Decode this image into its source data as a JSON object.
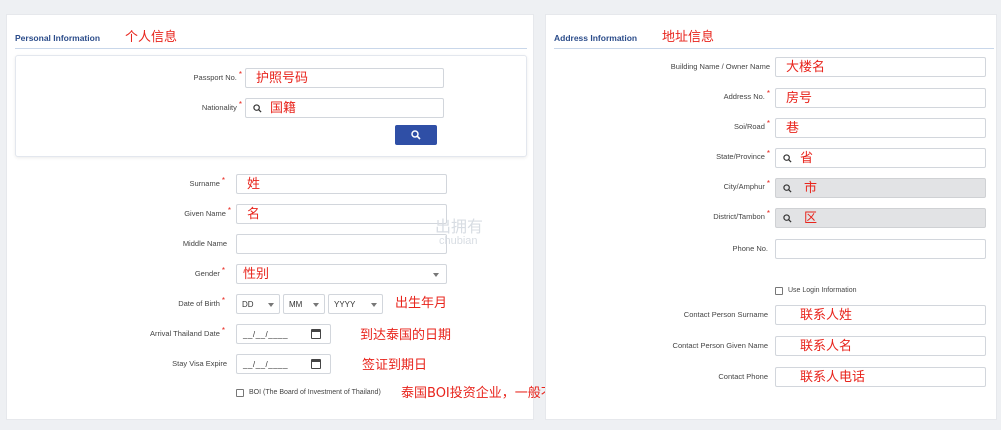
{
  "personal": {
    "title": "Personal Information",
    "annotation": "个人信息",
    "card": {
      "passport": {
        "label": "Passport No.",
        "annotation": "护照号码"
      },
      "nationality": {
        "label": "Nationality",
        "annotation": "国籍"
      }
    },
    "surname": {
      "label": "Surname",
      "annotation": "姓"
    },
    "given": {
      "label": "Given Name",
      "annotation": "名"
    },
    "middle": {
      "label": "Middle Name"
    },
    "gender": {
      "label": "Gender",
      "annotation": "性别"
    },
    "dob": {
      "label": "Date of Birth",
      "day": "DD",
      "month": "MM",
      "year": "YYYY",
      "annotation": "出生年月"
    },
    "arrival": {
      "label": "Arrival Thailand Date",
      "placeholder": "__/__/____",
      "annotation": "到达泰国的日期"
    },
    "visa": {
      "label": "Stay Visa Expire",
      "placeholder": "__/__/____",
      "annotation": "签证到期日"
    },
    "boi": {
      "label": "BOI (The Board of Investment of Thailand)",
      "annotation": "泰国BOI投资企业，一般不用选"
    }
  },
  "address": {
    "title": "Address Information",
    "annotation": "地址信息",
    "building": {
      "label": "Building Name / Owner Name",
      "annotation": "大楼名"
    },
    "address_no": {
      "label": "Address No.",
      "annotation": "房号"
    },
    "soi": {
      "label": "Soi/Road",
      "annotation": "巷"
    },
    "state": {
      "label": "State/Province",
      "annotation": "省"
    },
    "city": {
      "label": "City/Amphur",
      "annotation": "市"
    },
    "district": {
      "label": "District/Tambon",
      "annotation": "区"
    },
    "phone": {
      "label": "Phone No."
    },
    "use_login": {
      "label": "Use Login Information"
    },
    "contact_surname": {
      "label": "Contact Person Surname",
      "annotation": "联系人姓"
    },
    "contact_given": {
      "label": "Contact Person Given Name",
      "annotation": "联系人名"
    },
    "contact_phone": {
      "label": "Contact Phone",
      "annotation": "联系人电话"
    }
  },
  "required_mark": "*",
  "watermark": {
    "line1": "出拥有",
    "line2": "chubian"
  },
  "colors": {
    "annotation": "#e8241c",
    "section_title": "#2b4c8a",
    "search_button": "#2f4fa6"
  }
}
